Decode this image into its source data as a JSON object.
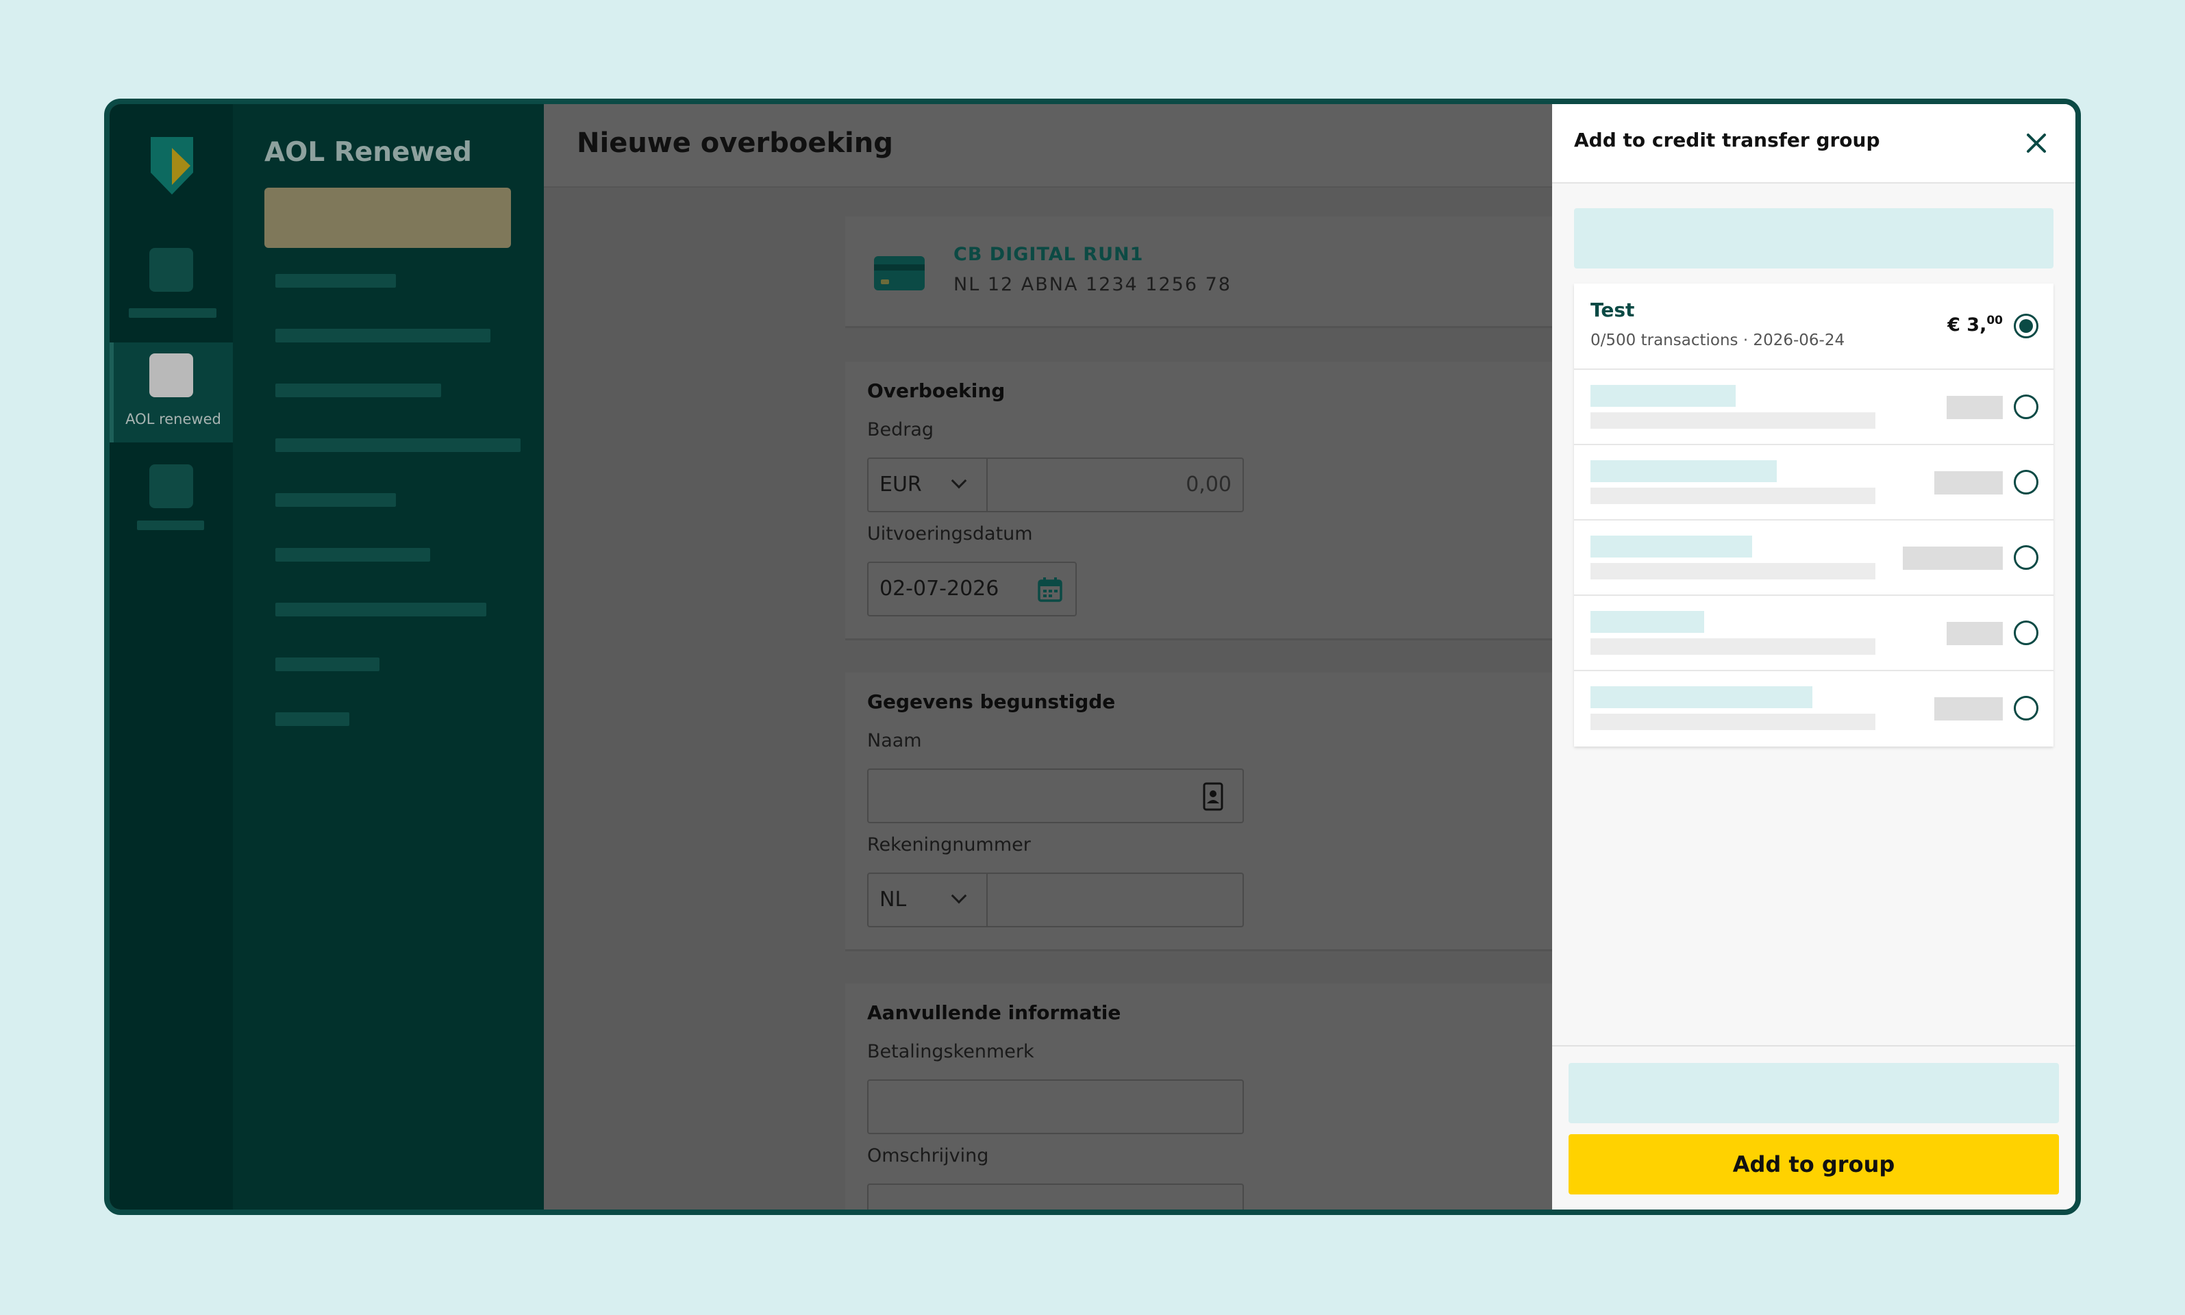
{
  "nav": {
    "title": "AOL Renewed"
  },
  "rail": {
    "active_label": "AOL renewed"
  },
  "main": {
    "title": "Nieuwe overboeking",
    "account": {
      "name": "CB DIGITAL RUN1",
      "number": "NL 12 ABNA 1234 1256 78"
    },
    "transfer": {
      "section_title": "Overboeking",
      "amount_label": "Bedrag",
      "currency": "EUR",
      "amount_placeholder": "0,00",
      "date_label": "Uitvoeringsdatum",
      "date_value": "02-07-2026"
    },
    "beneficiary": {
      "section_title": "Gegevens begunstigde",
      "name_label": "Naam",
      "account_label": "Rekeningnummer",
      "country": "NL"
    },
    "additional": {
      "section_title": "Aanvullende informatie",
      "reference_label": "Betalingskenmerk",
      "description_label": "Omschrijving"
    }
  },
  "panel": {
    "title": "Add to credit transfer group",
    "groups": [
      {
        "name": "Test",
        "meta": "0/500 transactions · 2026-06-24",
        "amount_main": "€ 3,",
        "amount_cents": "00",
        "selected": true
      }
    ],
    "add_button": "Add to group"
  },
  "colors": {
    "brand_green": "#0b4a45",
    "accent_yellow": "#ffd200",
    "skeleton_teal": "#d8eff0"
  }
}
